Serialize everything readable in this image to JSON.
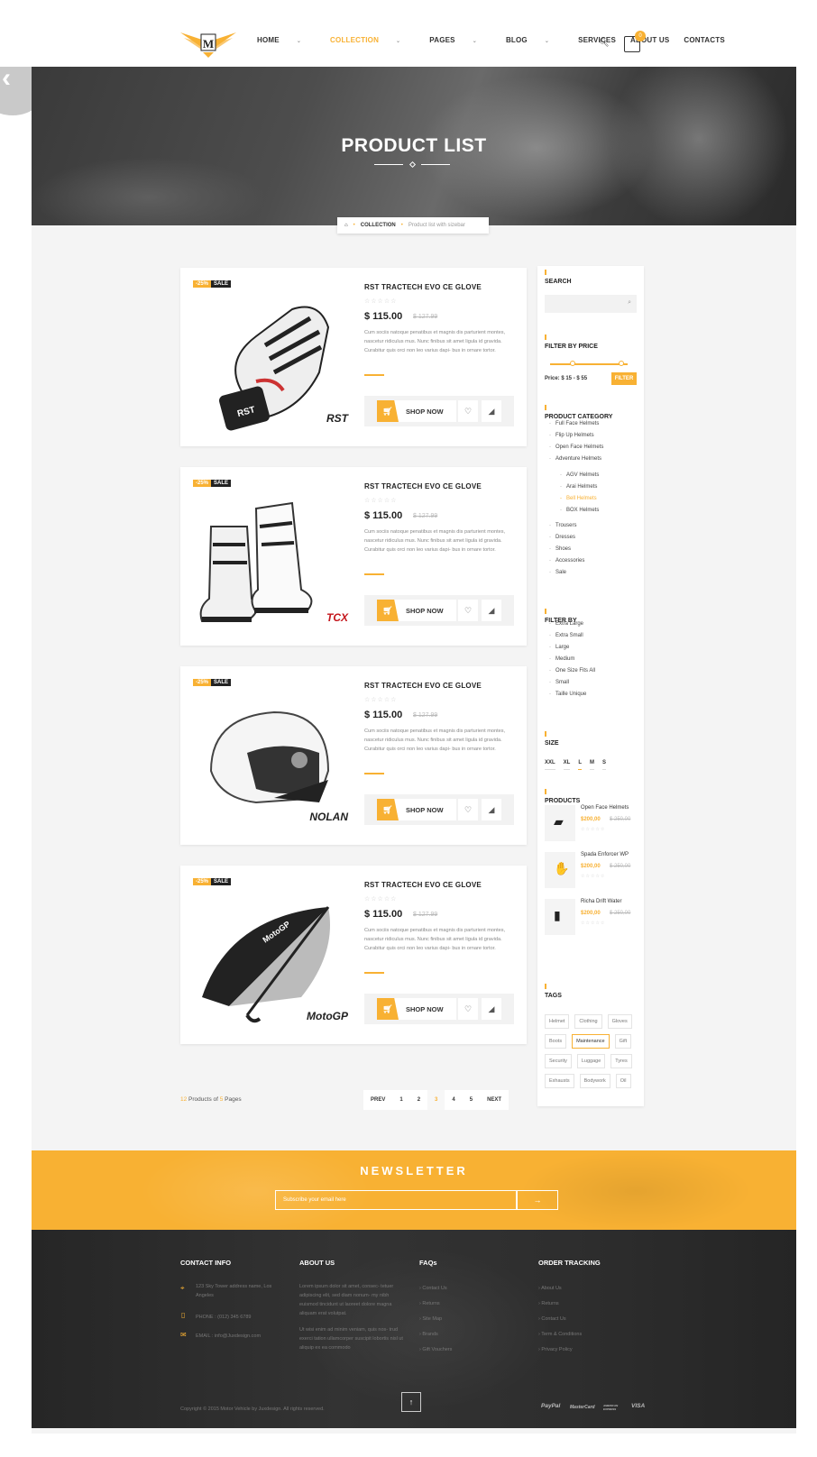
{
  "nav": {
    "items": [
      {
        "label": "HOME",
        "caret": true,
        "active": false
      },
      {
        "label": "COLLECTION",
        "caret": true,
        "active": true
      },
      {
        "label": "PAGES",
        "caret": true,
        "active": false
      },
      {
        "label": "BLOG",
        "caret": true,
        "active": false
      },
      {
        "label": "SERVICES",
        "caret": false,
        "active": false
      },
      {
        "label": "ABOUT US",
        "caret": false,
        "active": false
      },
      {
        "label": "CONTACTS",
        "caret": false,
        "active": false
      }
    ],
    "cart_count": "0"
  },
  "hero": {
    "title": "PRODUCT LIST"
  },
  "breadcrumb": {
    "home_icon": "home-icon",
    "collection": "COLLECTION",
    "current": "Product list with sizebar"
  },
  "products": [
    {
      "badge_pct": "-25%",
      "badge_sale": "SALE",
      "title": "RST TRACTECH EVO CE GLOVE",
      "price": "$ 115.00",
      "old_price": "$ 127.99",
      "desc": "Cum sociis natoque penatibus et magnis dis parturient montes, nascetur ridiculus mus. Nunc finibus sit amet ligula id gravida. Curabitur quis orci non leo varius dapi- bus in ornare tortor.",
      "shop": "SHOP NOW",
      "image": "glove",
      "brand": "RST"
    },
    {
      "badge_pct": "-25%",
      "badge_sale": "SALE",
      "title": "RST TRACTECH EVO CE GLOVE",
      "price": "$ 115.00",
      "old_price": "$ 127.99",
      "desc": "Cum sociis natoque penatibus et magnis dis parturient montes, nascetur ridiculus mus. Nunc finibus sit amet ligula id gravida. Curabitur quis orci non leo varius dapi- bus in ornare tortor.",
      "shop": "SHOP NOW",
      "image": "boots",
      "brand": "TCX"
    },
    {
      "badge_pct": "-25%",
      "badge_sale": "SALE",
      "title": "RST TRACTECH EVO CE GLOVE",
      "price": "$ 115.00",
      "old_price": "$ 127.99",
      "desc": "Cum sociis natoque penatibus et magnis dis parturient montes, nascetur ridiculus mus. Nunc finibus sit amet ligula id gravida. Curabitur quis orci non leo varius dapi- bus in ornare tortor.",
      "shop": "SHOP NOW",
      "image": "helmet",
      "brand": "NOLAN"
    },
    {
      "badge_pct": "-25%",
      "badge_sale": "SALE",
      "title": "RST TRACTECH EVO CE GLOVE",
      "price": "$ 115.00",
      "old_price": "$ 127.99",
      "desc": "Cum sociis natoque penatibus et magnis dis parturient montes, nascetur ridiculus mus. Nunc finibus sit amet ligula id gravida. Curabitur quis orci non leo varius dapi- bus in ornare tortor.",
      "shop": "SHOP NOW",
      "image": "umbrella",
      "brand": "MotoGP"
    }
  ],
  "sidebar": {
    "search_title": "SEARCH",
    "price_title": "FILTER BY PRICE",
    "price_label": "Price: $ 15 - $ 55",
    "filter_btn": "FILTER",
    "category_title": "PRODUCT CATEGORY",
    "categories": [
      "Full Face Helmets",
      "Flip Up Helmets",
      "Open Face Helmets",
      "Adventure Helmets"
    ],
    "subcategories": [
      {
        "label": "AGV Helmets",
        "active": false
      },
      {
        "label": "Arai Helmets",
        "active": false
      },
      {
        "label": "Bell Helmets",
        "active": true
      },
      {
        "label": "BOX Helmets",
        "active": false
      }
    ],
    "categories2": [
      "Trousers",
      "Dresses",
      "Shoes",
      "Accessories",
      "Sale"
    ],
    "filterby_title": "FILTER BY",
    "filterby": [
      "Extra Large",
      "Extra Small",
      "Large",
      "Medium",
      "One Size Fits All",
      "Small",
      "Taille Unique"
    ],
    "size_title": "SIZE",
    "sizes": [
      {
        "label": "XXL",
        "on": false
      },
      {
        "label": "XL",
        "on": false
      },
      {
        "label": "L",
        "on": true
      },
      {
        "label": "M",
        "on": false
      },
      {
        "label": "S",
        "on": false
      }
    ],
    "products_title": "PRODUCTS",
    "mini": [
      {
        "name": "Open Face Helmets",
        "price": "$200,00",
        "old": "$ 250,00"
      },
      {
        "name": "Spada Enforcer WP",
        "price": "$200,00",
        "old": "$ 250,00"
      },
      {
        "name": "Richa Drift Water",
        "price": "$200,00",
        "old": "$ 250,00"
      }
    ],
    "tags_title": "TAGS",
    "tags": [
      {
        "label": "Helmet",
        "on": false
      },
      {
        "label": "Clothing",
        "on": false
      },
      {
        "label": "Gloves",
        "on": false
      },
      {
        "label": "Boots",
        "on": false
      },
      {
        "label": "Maintenance",
        "on": true
      },
      {
        "label": "Gift",
        "on": false
      },
      {
        "label": "Security",
        "on": false
      },
      {
        "label": "Luggage",
        "on": false
      },
      {
        "label": "Tyres",
        "on": false
      },
      {
        "label": "Exhausts",
        "on": false
      },
      {
        "label": "Bodywork",
        "on": false
      },
      {
        "label": "Oil",
        "on": false
      }
    ]
  },
  "pagination": {
    "count_num": "12",
    "count_mid": " Products of ",
    "count_pages": "5",
    "count_end": " Pages",
    "prev": "PREV",
    "pages": [
      "1",
      "2",
      "3",
      "4",
      "5"
    ],
    "current": "3",
    "next": "NEXT"
  },
  "newsletter": {
    "title": "NEWSLETTER",
    "placeholder": "Subscribe your email here",
    "button": "→"
  },
  "footer": {
    "contact_title": "CONTACT INFO",
    "address": "123 Sky Tower address name, Los Angeles",
    "phone": "PHONE : (012) 345 6789",
    "email": "EMAIL : info@Juxdesign.com",
    "about_title": "ABOUT US",
    "about_p1": "Lorem ipsum dolor sit amet, consec- tetuer adipiscing elit, sed diam nonum- my nibh euismod tincidunt ut laoreet dolore magna aliquam erat volutpat.",
    "about_p2": "Ut wisi enim ad minim veniam, quis nos- trud exerci tation ullamcorper suscipit lobortis nisl ut aliquip ex ea commodo",
    "faq_title": "FAQs",
    "faqs": [
      "Contact Us",
      "Returns",
      "Site Map",
      "Brands",
      "Gift Vouchers"
    ],
    "tracking_title": "ORDER TRACKING",
    "tracking": [
      "About Us",
      "Returns",
      "Contact Us",
      "Term & Conditions",
      "Privacy Policy"
    ],
    "copyright": "Copyright © 2015 Motor Vehicle by Juxdesign. All rights reserved.",
    "top": "↑",
    "payments": [
      "PayPal",
      "MasterCard",
      "AMERICAN EXPRESS",
      "VISA"
    ]
  },
  "colors": {
    "accent": "#f8b133",
    "dark": "#222222"
  }
}
